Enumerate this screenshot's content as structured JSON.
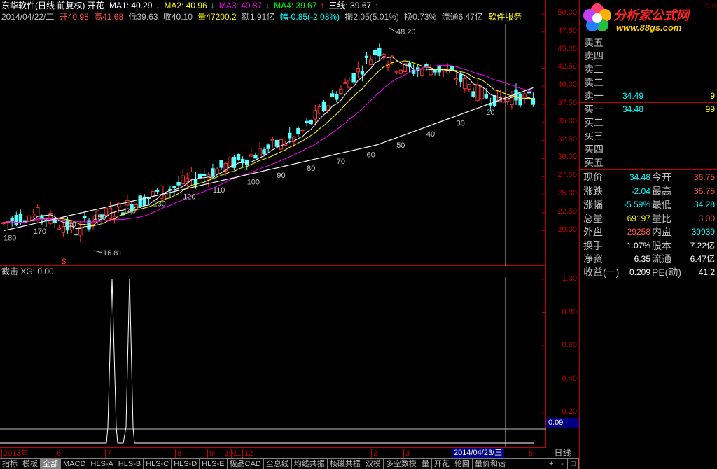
{
  "header": {
    "stock_title": "东华软件(日线 前复权) 开花",
    "ma": [
      {
        "label": "MA1: 40.29",
        "arrow": "↓",
        "color": "#ffffff"
      },
      {
        "label": "MA2: 40.96",
        "arrow": "↓",
        "color": "#ffff00"
      },
      {
        "label": "MA3: 40.87",
        "arrow": "↓",
        "color": "#ff00ff"
      },
      {
        "label": "MA4: 39.67",
        "arrow": "↑",
        "color": "#00ff00"
      },
      {
        "label": "三线: 39.67",
        "arrow": "↑",
        "color": "#ffffff"
      }
    ]
  },
  "info": {
    "date": "2014/04/22/二",
    "open": "开40.98",
    "high": "高41.68",
    "low": "低39.63",
    "close": "收40.10",
    "volume": "量47200.2",
    "amount": "额1.91亿",
    "change": "幅-0.85(-2.08%)",
    "amplitude": "振2.05(5.01%)",
    "turnover": "换0.73%",
    "float": "流通6.47亿",
    "sector": "软件服务"
  },
  "price_axis": [
    "50.00",
    "47.50",
    "45.00",
    "42.50",
    "40.00",
    "37.50",
    "35.00",
    "32.50",
    "30.00",
    "27.50",
    "25.00",
    "22.50",
    "20.00"
  ],
  "annotations": {
    "max_label": "48.20",
    "min_label": "16.81",
    "ma_counts": [
      "180",
      "170",
      "160",
      "150",
      "140",
      "130",
      "120",
      "110",
      "100",
      "90",
      "80",
      "70",
      "60",
      "50",
      "40",
      "30",
      "20"
    ],
    "signal_marker": "$"
  },
  "sub_chart": {
    "title": "截击  XG: 0.00",
    "axis": [
      "1.00",
      "0.80",
      "0.60",
      "0.40",
      "0.20"
    ],
    "current_value": "0.09"
  },
  "date_axis": {
    "ticks": [
      "2013年",
      "6",
      "7",
      "8",
      "9",
      "10",
      "11",
      "12",
      "2",
      "3",
      "4",
      "5"
    ],
    "cursor": "2014/04/23/三"
  },
  "period": "日线",
  "tabs": [
    "指标",
    "模板",
    "全部",
    "MACD",
    "HLS-A",
    "HLS-B",
    "HLS-C",
    "HLS-D",
    "HLS-E",
    "极品CAD",
    "全息线",
    "均线共振",
    "核磁共振",
    "双模",
    "多空数模",
    "量",
    "开花",
    "轮回",
    "量价和谐"
  ],
  "zoom": [
    "+",
    "-",
    "□"
  ],
  "logo": {
    "name": "分析家公式网",
    "url": "www.88gs.com"
  },
  "order_book": {
    "sell": [
      {
        "label": "卖五",
        "price": "",
        "vol": ""
      },
      {
        "label": "卖四",
        "price": "",
        "vol": ""
      },
      {
        "label": "卖三",
        "price": "",
        "vol": ""
      },
      {
        "label": "卖二",
        "price": "",
        "vol": ""
      },
      {
        "label": "卖一",
        "price": "34.49",
        "vol": "9"
      }
    ],
    "buy": [
      {
        "label": "买一",
        "price": "34.48",
        "vol": "99"
      },
      {
        "label": "买二",
        "price": "",
        "vol": ""
      },
      {
        "label": "买三",
        "price": "",
        "vol": ""
      },
      {
        "label": "买四",
        "price": "",
        "vol": ""
      },
      {
        "label": "买五",
        "price": "",
        "vol": ""
      }
    ]
  },
  "quote": [
    {
      "l1": "现价",
      "v1": "34.48",
      "c1": "cyan",
      "l2": "今开",
      "v2": "36.75",
      "c2": "red"
    },
    {
      "l1": "涨跌",
      "v1": "-2.04",
      "c1": "cyan",
      "l2": "最高",
      "v2": "36.75",
      "c2": "red"
    },
    {
      "l1": "涨幅",
      "v1": "-5.59%",
      "c1": "cyan",
      "l2": "最低",
      "v2": "34.28",
      "c2": "cyan"
    },
    {
      "l1": "总量",
      "v1": "69197",
      "c1": "yellow",
      "l2": "量比",
      "v2": "3.00",
      "c2": "red"
    },
    {
      "l1": "外盘",
      "v1": "29258",
      "c1": "red",
      "l2": "内盘",
      "v2": "39939",
      "c2": "cyan"
    }
  ],
  "fundamentals": [
    {
      "l1": "换手",
      "v1": "1.07%",
      "l2": "股本",
      "v2": "7.22亿"
    },
    {
      "l1": "净资",
      "v1": "6.35",
      "l2": "流通",
      "v2": "6.47亿"
    },
    {
      "l1": "收益(一)",
      "v1": "0.209",
      "l2": "PE(动)",
      "v2": "41.2"
    }
  ]
}
